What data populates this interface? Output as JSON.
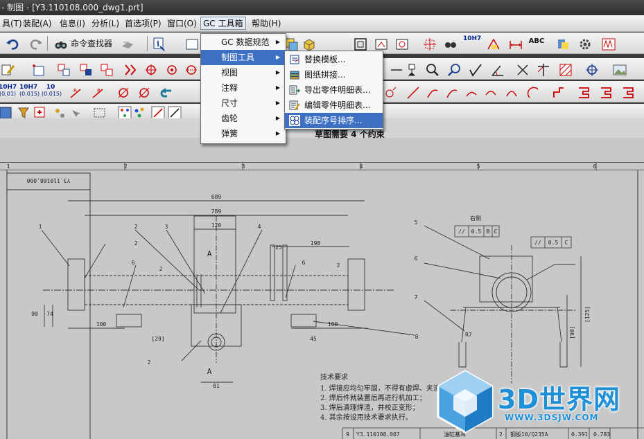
{
  "window": {
    "title": "- 制图 - [Y3.110108.000_dwg1.prt]"
  },
  "menubar": {
    "items": [
      {
        "label": "具(T)"
      },
      {
        "label": "装配(A)"
      },
      {
        "label": "信息(I)"
      },
      {
        "label": "分析(L)"
      },
      {
        "label": "首选项(P)"
      },
      {
        "label": "窗口(O)"
      },
      {
        "label": "GC 工具箱"
      },
      {
        "label": "帮助(H)"
      }
    ]
  },
  "toolbar": {
    "command_finder": "命令查找器",
    "tol_labels": [
      {
        "main": "10H7",
        "sub": "(0,01)"
      },
      {
        "main": "10H7",
        "sub": "(0.015)"
      },
      {
        "main": "10",
        "sub": "(0.015)"
      }
    ],
    "fit_label": "10H7",
    "abc_label": "ABC"
  },
  "gc_menu": {
    "items": [
      {
        "label": "GC 数据规范",
        "has_submenu": true
      },
      {
        "label": "制图工具",
        "has_submenu": true,
        "highlighted": true
      },
      {
        "label": "视图",
        "has_submenu": true
      },
      {
        "label": "注释",
        "has_submenu": true
      },
      {
        "label": "尺寸",
        "has_submenu": true
      },
      {
        "label": "齿轮",
        "has_submenu": true
      },
      {
        "label": "弹簧",
        "has_submenu": true
      }
    ]
  },
  "drafting_submenu": {
    "items": [
      {
        "label": "替换模板...",
        "icon": "template-icon"
      },
      {
        "label": "图纸拼接...",
        "icon": "sheet-join-icon"
      },
      {
        "label": "导出零件明细表...",
        "icon": "export-parts-list-icon"
      },
      {
        "label": "编辑零件明细表...",
        "icon": "edit-parts-list-icon"
      },
      {
        "label": "装配序号排序...",
        "icon": "balloon-sort-icon",
        "highlighted": true
      }
    ]
  },
  "status": {
    "message": "草图需要 4 个约束"
  },
  "drawing": {
    "border_zones": [
      "1",
      "2",
      "3",
      "4",
      "5",
      "6"
    ],
    "drawing_number_mirror": "Y3.110108.000",
    "dims_main": [
      "689",
      "789",
      "120",
      "198",
      "25",
      "74",
      "90",
      "100",
      "100",
      "[29]",
      "81",
      "45",
      "A"
    ],
    "dims_side": [
      "[125]",
      "[90]",
      "R7"
    ],
    "balloons": [
      "1",
      "2",
      "3",
      "4",
      "5",
      "6",
      "7",
      "8",
      "2",
      "2",
      "2",
      "2",
      "6",
      "6"
    ],
    "side_label": "右侧",
    "fcf": [
      {
        "sym": "//",
        "value": "0.5",
        "ref": "B",
        "ref2": "C"
      },
      {
        "sym": "//",
        "value": "0.5",
        "ref": "C",
        "ref2": ""
      }
    ],
    "tech_title": "技术要求",
    "tech_notes": [
      "1. 焊接应均匀牢固，不得有虚焊、夹渣、气孔等缺陷；",
      "2. 焊后件就装置后再进行机加工；",
      "3. 焊后清理焊渣，并校正变形；",
      "4. 其余按设用技术要求执行。"
    ],
    "title_row": [
      "9",
      "Y3.110108.007",
      "油缸基耳",
      "2",
      "钢板10/Q235A",
      "0.391",
      "0.783"
    ]
  },
  "watermark": {
    "text": "3D世界网",
    "url": "WWW.3DSJW.COM"
  },
  "colors": {
    "menu_highlight": "#3d6fc2",
    "paper": "#c8c8c8",
    "watermark": "#1f8fd8"
  }
}
